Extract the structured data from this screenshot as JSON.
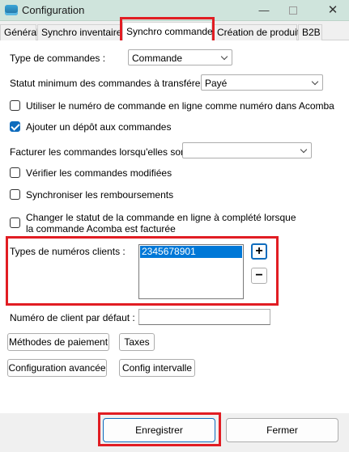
{
  "window": {
    "title": "Configuration",
    "icon": "app-icon",
    "controls": {
      "minimize": "—",
      "close": "✕"
    }
  },
  "tabs": [
    {
      "label": "Général",
      "active": false
    },
    {
      "label": "Synchro inventaires",
      "active": false
    },
    {
      "label": "Synchro commandes",
      "active": true
    },
    {
      "label": "Création de produits",
      "active": false
    },
    {
      "label": "B2B",
      "active": false
    }
  ],
  "form": {
    "order_type": {
      "label": "Type de commandes :",
      "value": "Commande"
    },
    "min_status": {
      "label": "Statut minimum des commandes à transférer :",
      "value": "Payé"
    },
    "use_online_number": {
      "label": "Utiliser le numéro de commande en ligne comme numéro dans Acomba",
      "checked": false
    },
    "add_deposit": {
      "label": "Ajouter un dépôt aux commandes",
      "checked": true
    },
    "invoice_when": {
      "label": "Facturer les commandes lorsqu'elles sont :",
      "value": ""
    },
    "check_modified": {
      "label": "Vérifier les commandes modifiées",
      "checked": false
    },
    "sync_refunds": {
      "label": "Synchroniser les remboursements",
      "checked": false
    },
    "change_status": {
      "label_line1": "Changer le statut de la commande en ligne à complété lorsque",
      "label_line2": "la commande Acomba est facturée",
      "checked": false
    },
    "client_number_types": {
      "label": "Types de numéros clients :",
      "items": [
        "2345678901"
      ],
      "add": "+",
      "remove": "−"
    },
    "default_client_number": {
      "label": "Numéro de client par défaut :",
      "value": ""
    }
  },
  "buttons": {
    "payment_methods": "Méthodes de paiement",
    "taxes": "Taxes",
    "advanced_config": "Configuration avancée",
    "interval_config": "Config intervalle",
    "save": "Enregistrer",
    "close": "Fermer"
  },
  "colors": {
    "highlight": "#e11d23",
    "accent": "#0f6cbd",
    "selection": "#0078d7",
    "titlebar": "#cfe4dc"
  }
}
